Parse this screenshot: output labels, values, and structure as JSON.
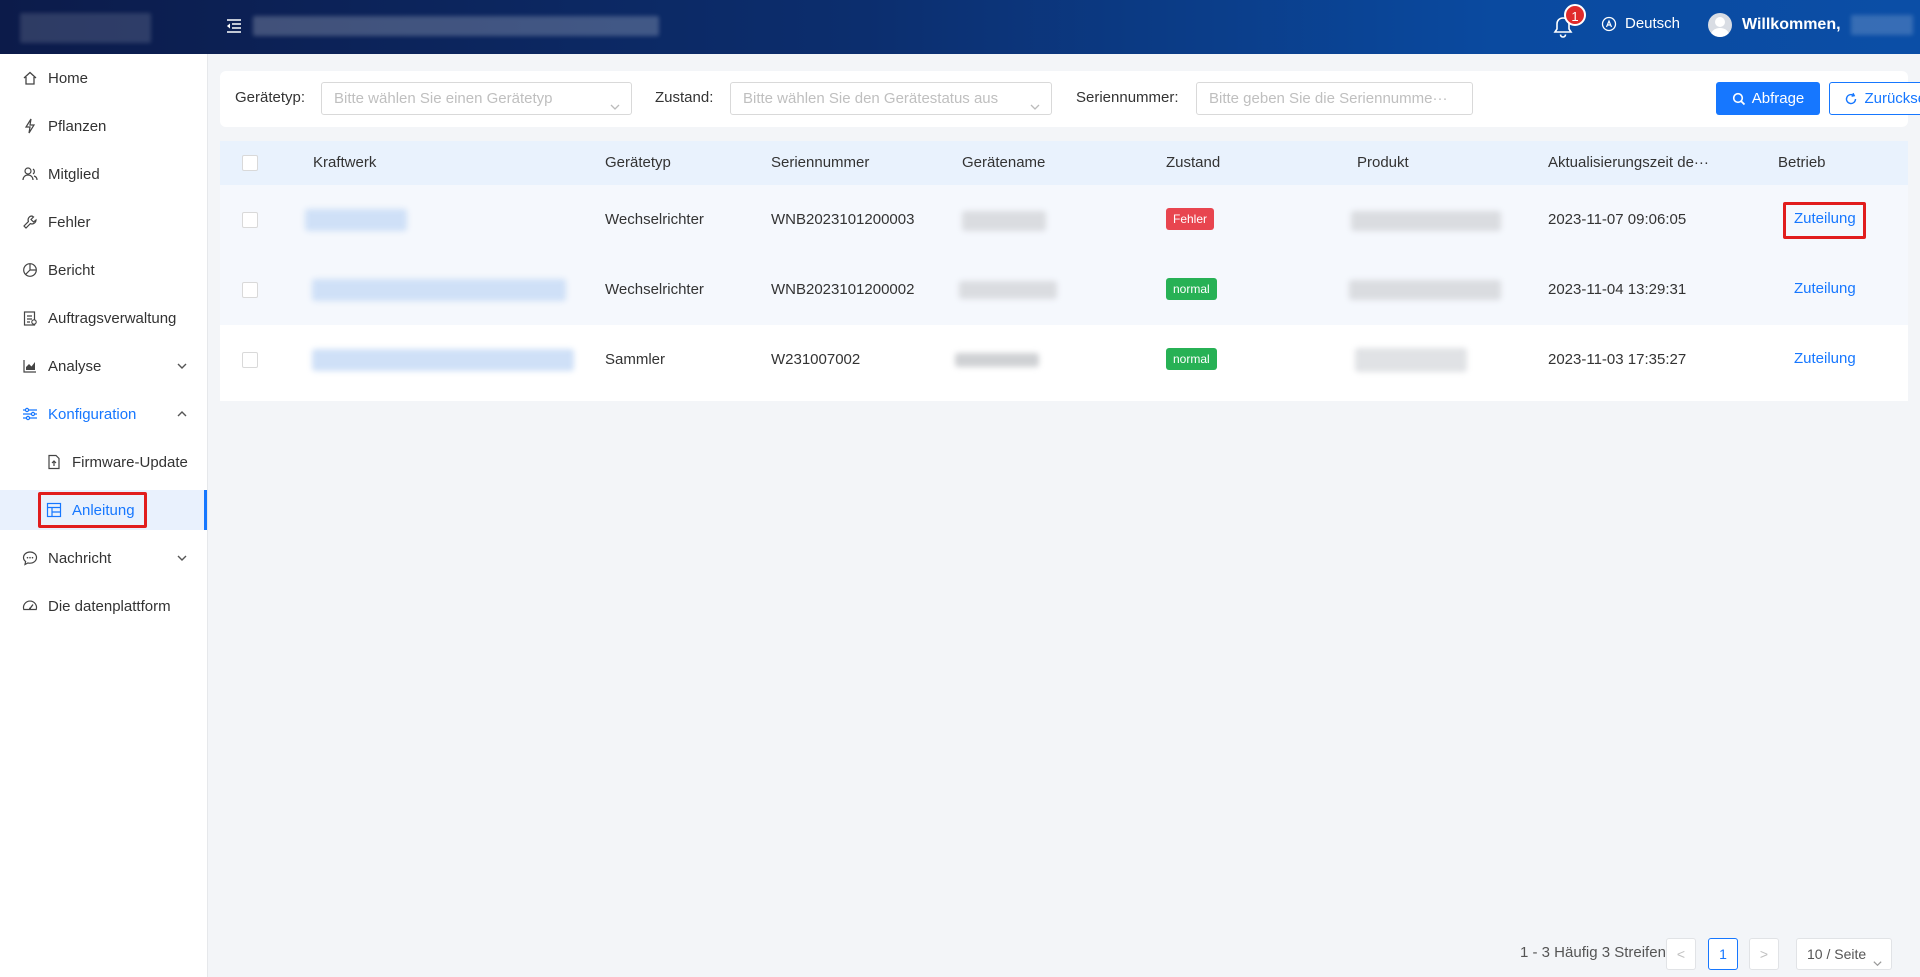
{
  "header": {
    "notification_count": "1",
    "language": "Deutsch",
    "welcome": "Willkommen,"
  },
  "sidebar": {
    "items": [
      {
        "label": "Home",
        "icon": "home-icon"
      },
      {
        "label": "Pflanzen",
        "icon": "lightning-icon"
      },
      {
        "label": "Mitglied",
        "icon": "users-icon"
      },
      {
        "label": "Fehler",
        "icon": "wrench-icon"
      },
      {
        "label": "Bericht",
        "icon": "pie-chart-icon"
      },
      {
        "label": "Auftragsverwaltung",
        "icon": "clipboard-icon"
      },
      {
        "label": "Analyse",
        "icon": "area-chart-icon"
      },
      {
        "label": "Konfiguration",
        "icon": "sliders-icon"
      },
      {
        "label": "Firmware-Update",
        "icon": "file-icon"
      },
      {
        "label": "Anleitung",
        "icon": "layout-icon"
      },
      {
        "label": "Nachricht",
        "icon": "message-icon"
      },
      {
        "label": "Die datenplattform",
        "icon": "dashboard-icon"
      }
    ]
  },
  "filters": {
    "device_type_label": "Gerätetyp",
    "device_type_placeholder": "Bitte wählen Sie einen Gerätetyp",
    "status_label": "Zustand",
    "status_placeholder": "Bitte wählen Sie den Gerätestatus aus",
    "serial_label": "Seriennummer",
    "serial_placeholder": "Bitte geben Sie die Seriennumme···",
    "search_label": "Abfrage",
    "reset_label": "Zurücksetzen"
  },
  "table": {
    "columns": [
      "Kraftwerk",
      "Gerätetyp",
      "Seriennummer",
      "Gerätename",
      "Zustand",
      "Produkt",
      "Aktualisierungszeit de···",
      "Betrieb"
    ],
    "rows": [
      {
        "type": "Wechselrichter",
        "serial": "WNB2023101200003",
        "status": "Fehler",
        "status_kind": "error",
        "time": "2023-11-07 09:06:05",
        "action": "Zuteilung"
      },
      {
        "type": "Wechselrichter",
        "serial": "WNB2023101200002",
        "status": "normal",
        "status_kind": "ok",
        "time": "2023-11-04 13:29:31",
        "action": "Zuteilung"
      },
      {
        "type": "Sammler",
        "serial": "W231007002",
        "status": "normal",
        "status_kind": "ok",
        "time": "2023-11-03 17:35:27",
        "action": "Zuteilung"
      }
    ]
  },
  "pagination": {
    "summary": "1 - 3 Häufig 3 Streifen",
    "prev": "<",
    "current": "1",
    "next": ">",
    "page_size": "10 / Seite"
  },
  "colors": {
    "accent": "#1677ff",
    "error_tag": "#e8454f",
    "ok_tag": "#27b155",
    "highlight": "#e11d1d"
  }
}
